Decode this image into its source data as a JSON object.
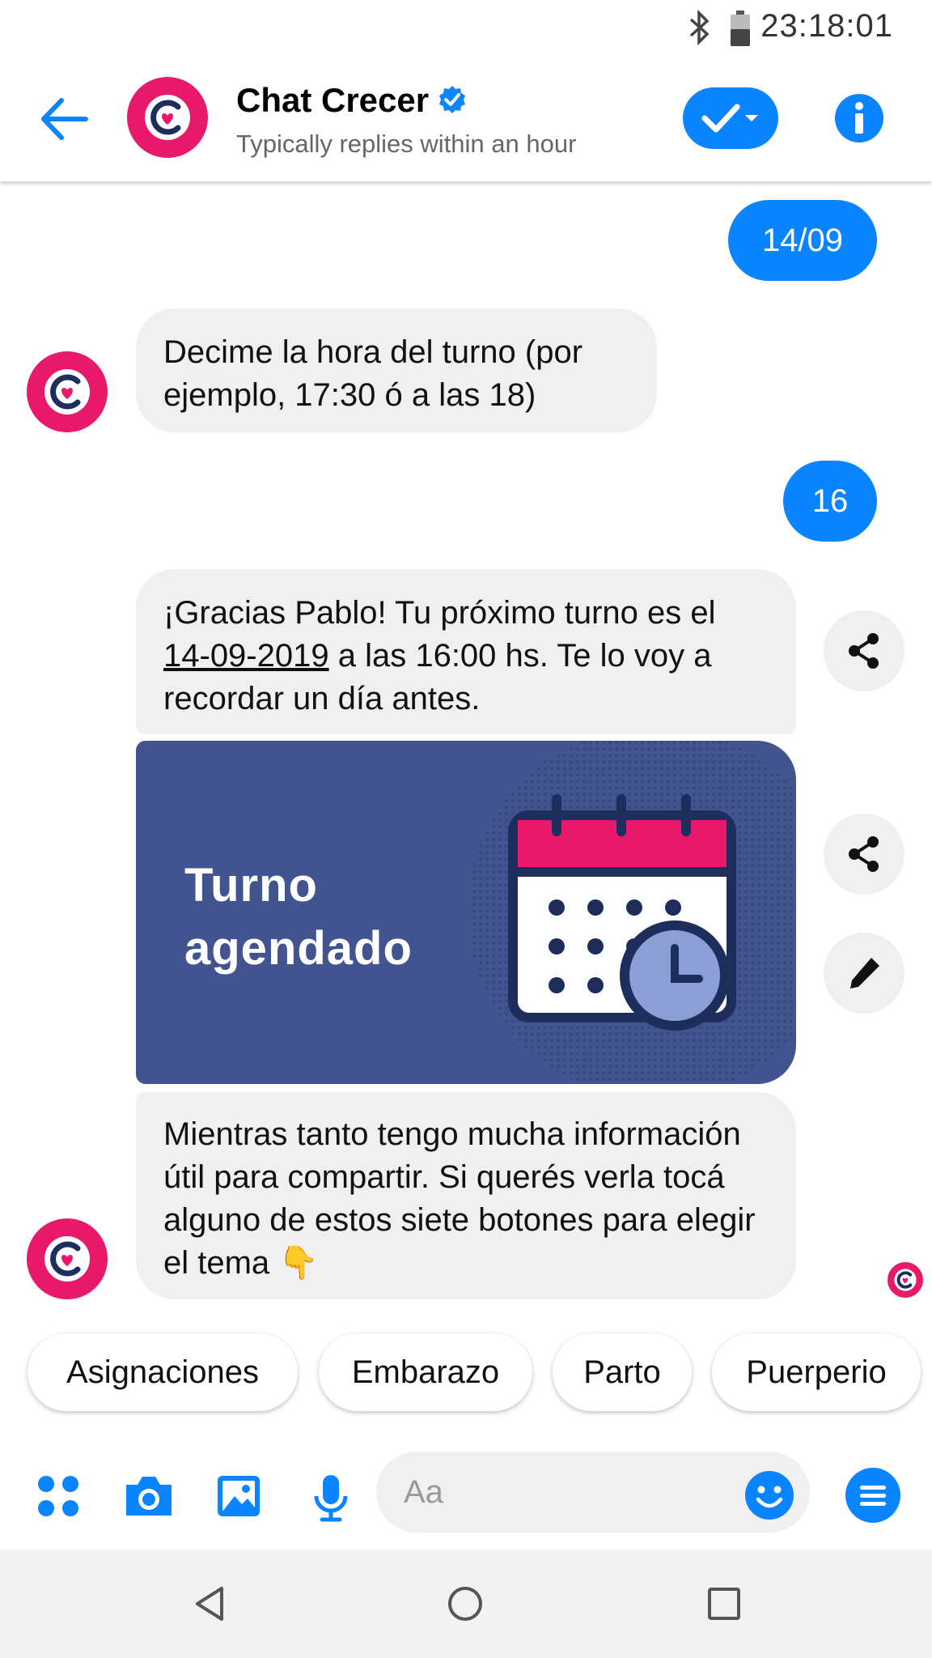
{
  "status_bar": {
    "time": "23:18:01"
  },
  "header": {
    "title": "Chat Crecer",
    "subtitle": "Typically replies within an hour"
  },
  "messages": {
    "out_1": "14/09",
    "in_1": "Decime la hora del turno (por ejemplo, 17:30 ó a las 18)",
    "out_2": "16",
    "in_2_pre": "¡Gracias Pablo! Tu próximo turno es el ",
    "in_2_date": "14-09-2019",
    "in_2_post": " a las 16:00 hs. Te lo voy a recordar un día antes.",
    "card_line1": "Turno",
    "card_line2": "agendado",
    "in_3": "Mientras tanto tengo mucha información útil para compartir. Si querés verla tocá alguno de estos siete botones para elegir el tema",
    "in_3_emoji": "👇"
  },
  "quick_replies": [
    "Asignaciones",
    "Embarazo",
    "Parto",
    "Puerperio"
  ],
  "composer": {
    "placeholder": "Aa"
  },
  "colors": {
    "accent": "#0a84ff",
    "brand": "#e8196a",
    "card": "#41548f",
    "bubble_in": "#f0f0f0"
  }
}
